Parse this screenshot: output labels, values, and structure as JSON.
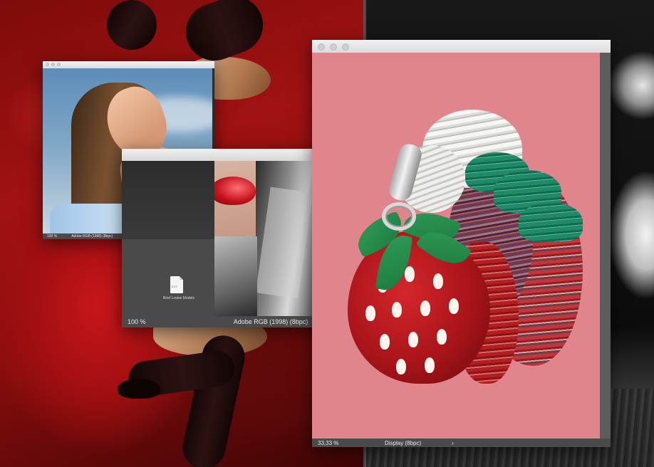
{
  "windows": {
    "portrait": {
      "zoom": "100 %",
      "color_profile": "Adobe RGB (1998) (8bpc)",
      "arrow": "›"
    },
    "collage": {
      "zoom": "100 %",
      "color_profile": "Adobe RGB (1998) (8bpc)",
      "arrow": "›",
      "file_icon_text": "EXT",
      "file_label": "Brief Louise Models",
      "smiley": "☺"
    },
    "strawberry": {
      "zoom": "33,33 %",
      "color_profile": "Display (8bpc)",
      "arrow": "›",
      "canvas_color": "#e1858c"
    }
  },
  "colors": {
    "titlebar": "#e4e4e4",
    "statusbar": "#4a4a4a",
    "statusbar_text": "#e8e8e8",
    "background_left": "#a11212",
    "background_right": "#0c0c0c"
  }
}
